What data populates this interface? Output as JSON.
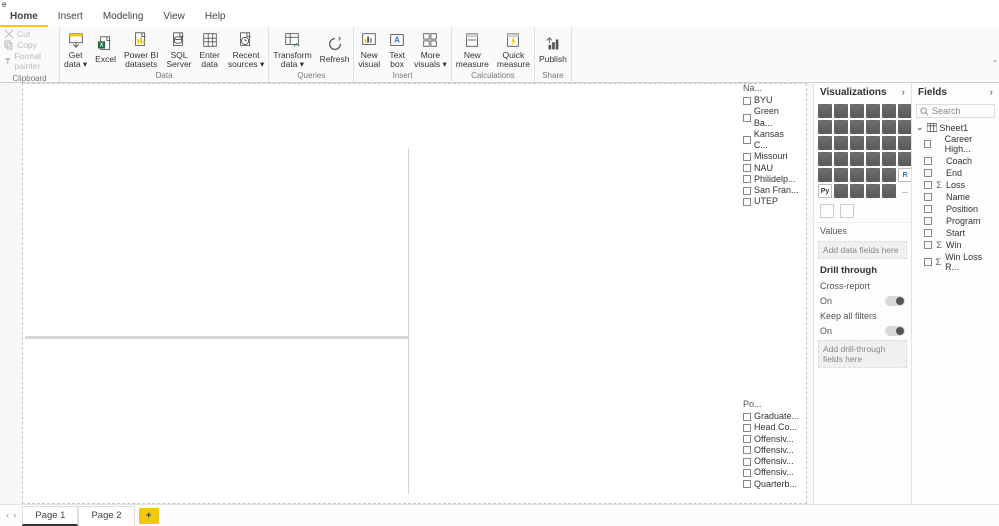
{
  "menu": {
    "tabs": [
      "Home",
      "Insert",
      "Modeling",
      "View",
      "Help"
    ],
    "active": 0,
    "corner": "e"
  },
  "ribbon": {
    "clipboard": {
      "cut": "Cut",
      "copy": "Copy",
      "fp": "Format painter",
      "label": "Clipboard"
    },
    "data": {
      "label": "Data",
      "buttons": [
        {
          "n": "get-data",
          "l": "Get\ndata ▾"
        },
        {
          "n": "excel",
          "l": "Excel"
        },
        {
          "n": "pbi-datasets",
          "l": "Power BI\ndatasets"
        },
        {
          "n": "sql-server",
          "l": "SQL\nServer"
        },
        {
          "n": "enter-data",
          "l": "Enter\ndata"
        },
        {
          "n": "recent-sources",
          "l": "Recent\nsources ▾"
        }
      ]
    },
    "queries": {
      "label": "Queries",
      "buttons": [
        {
          "n": "transform-data",
          "l": "Transform\ndata ▾"
        },
        {
          "n": "refresh",
          "l": "Refresh"
        }
      ]
    },
    "insert": {
      "label": "Insert",
      "buttons": [
        {
          "n": "new-visual",
          "l": "New\nvisual"
        },
        {
          "n": "text-box",
          "l": "Text\nbox"
        },
        {
          "n": "more-visuals",
          "l": "More\nvisuals ▾"
        }
      ]
    },
    "calc": {
      "label": "Calculations",
      "buttons": [
        {
          "n": "new-measure",
          "l": "New\nmeasure"
        },
        {
          "n": "quick-measure",
          "l": "Quick\nmeasure"
        }
      ]
    },
    "share": {
      "label": "Share",
      "buttons": [
        {
          "n": "publish",
          "l": "Publish"
        }
      ]
    }
  },
  "slicers": {
    "name": {
      "hdr": "Na...",
      "items": [
        "BYU",
        "Green Ba...",
        "Kansas C...",
        "Missouri",
        "NAU",
        "Philidelp...",
        "San Fran...",
        "UTEP"
      ]
    },
    "position": {
      "hdr": "Po...",
      "items": [
        "Graduate...",
        "Head Co...",
        "Offensiv...",
        "Offensiv...",
        "Offensiv...",
        "Offensiv...",
        "Quarterb..."
      ]
    }
  },
  "viz": {
    "title": "Visualizations",
    "values_label": "Values",
    "values_well": "Add data fields here",
    "drill": "Drill through",
    "cross": "Cross-report",
    "keep": "Keep all filters",
    "on": "On",
    "drill_well": "Add drill-through fields here"
  },
  "fields": {
    "title": "Fields",
    "search": "Search",
    "table": "Sheet1",
    "cols": [
      {
        "n": "Career High...",
        "s": false
      },
      {
        "n": "Coach",
        "s": false
      },
      {
        "n": "End",
        "s": false
      },
      {
        "n": "Loss",
        "s": true
      },
      {
        "n": "Name",
        "s": false
      },
      {
        "n": "Position",
        "s": false
      },
      {
        "n": "Program",
        "s": false
      },
      {
        "n": "Start",
        "s": false
      },
      {
        "n": "Win",
        "s": true
      },
      {
        "n": "Win Loss R...",
        "s": true
      }
    ]
  },
  "pages": {
    "tabs": [
      "Page 1",
      "Page 2"
    ],
    "active": 0
  }
}
